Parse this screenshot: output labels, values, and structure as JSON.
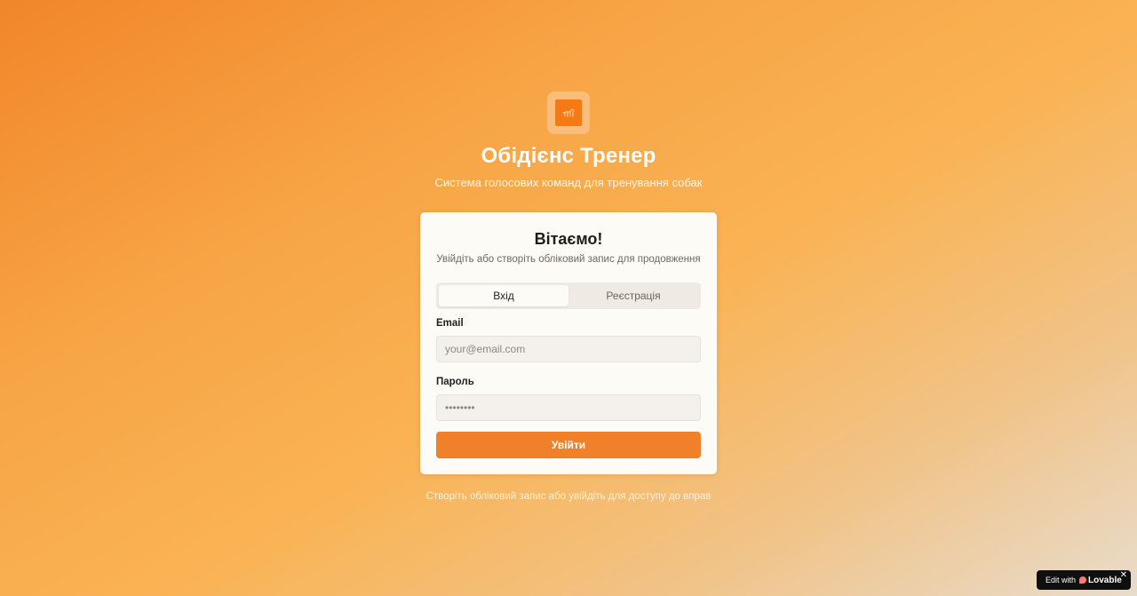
{
  "app": {
    "title": "Обідієнс Тренер",
    "subtitle": "Система голосових команд для тренування собак"
  },
  "card": {
    "title": "Вітаємо!",
    "description": "Увійдіть або створіть обліковий запис для продовження",
    "tabs": [
      {
        "label": "Вхід",
        "active": true
      },
      {
        "label": "Реєстрація",
        "active": false
      }
    ],
    "email": {
      "label": "Email",
      "placeholder": "your@email.com",
      "value": ""
    },
    "password": {
      "label": "Пароль",
      "placeholder": "••••••••",
      "value": ""
    },
    "submit_label": "Увійти"
  },
  "footer": {
    "note": "Створіть обліковий запис або увійдіть для доступу до вправ"
  },
  "badge": {
    "prefix": "Edit with",
    "brand": "Lovable",
    "close": "✕"
  },
  "colors": {
    "accent": "#f0812a",
    "logo_tile": "#fbbd7c",
    "logo_inner": "#f57a14"
  },
  "icons": {
    "logo": "dog-icon",
    "badge": "lovable-heart-icon",
    "close": "close-icon"
  }
}
